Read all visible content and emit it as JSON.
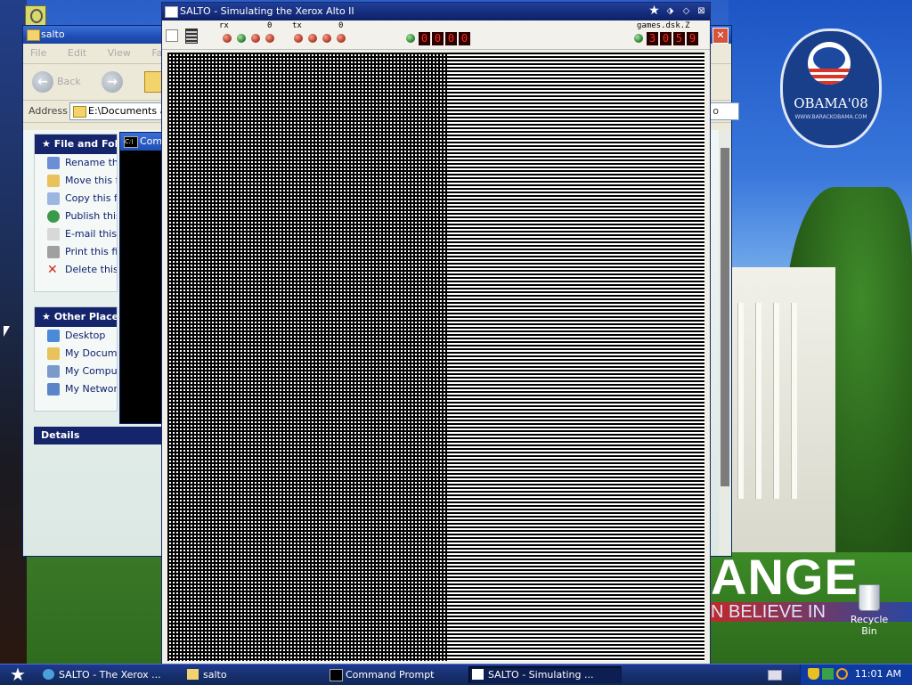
{
  "desktop": {
    "poster": {
      "logo_text": "OBAMA'08",
      "logo_sub": "WWW.BARACKOBAMA.COM",
      "headline": "ANGE",
      "tagline": "N BELIEVE IN"
    },
    "recycle_bin_label": "Recycle Bin"
  },
  "explorer": {
    "title": "salto",
    "menu": [
      "File",
      "Edit",
      "View",
      "Favorites"
    ],
    "back_label": "Back",
    "address_label": "Address",
    "address_value": "E:\\Documents and",
    "go_label": "o",
    "file_tasks": {
      "header": "File and Folder",
      "items": [
        "Rename this",
        "Move this file",
        "Copy this file",
        "Publish this",
        "E-mail this fil",
        "Print this file",
        "Delete this fi"
      ]
    },
    "other_places": {
      "header": "Other Places",
      "items": [
        "Desktop",
        "My Documen",
        "My Compute",
        "My Network"
      ]
    },
    "details_header": "Details"
  },
  "cmd": {
    "title": "Comm"
  },
  "salto": {
    "title": "SALTO - Simulating the Xerox Alto II",
    "rx_label": "rx",
    "rx_count": "0",
    "tx_label": "tx",
    "tx_count": "0",
    "counter_digits": [
      "0",
      "0",
      "0",
      "0"
    ],
    "disk_label": "games.dsk.Z",
    "disk_digits": [
      "3",
      "0",
      "5",
      "9"
    ]
  },
  "taskbar": {
    "tasks": [
      {
        "label": "SALTO - The Xerox ..."
      },
      {
        "label": "salto"
      },
      {
        "label": "Command Prompt"
      },
      {
        "label": "SALTO - Simulating ..."
      }
    ],
    "clock": "11:01 AM"
  },
  "colors": {
    "titlebar": "#1f4fb5",
    "taskbar": "#17306e",
    "led_red": "#b8402c",
    "led_green": "#2f8a3a",
    "digit_red": "#ff2a1a"
  }
}
